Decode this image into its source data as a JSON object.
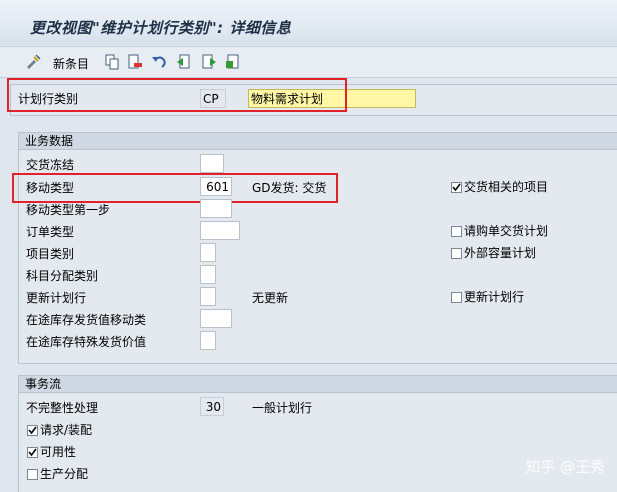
{
  "title": "更改视图\"维护计划行类别\": 详细信息",
  "toolbar": {
    "new_entries_label": "新条目",
    "icons": [
      "display-change-icon",
      "copy-icon",
      "delete-icon",
      "undo-icon",
      "previous-entry-icon",
      "next-entry-icon",
      "transport-icon"
    ]
  },
  "header": {
    "schedule_line_category_label": "计划行类别",
    "schedule_line_category_value": "CP",
    "description_value": "物料需求计划"
  },
  "business_data": {
    "title": "业务数据",
    "delivery_block_label": "交货冻结",
    "movement_type_label": "移动类型",
    "movement_type_value": "601",
    "movement_type_desc": "GD发货: 交货",
    "movement_type_1step_label": "移动类型第一步",
    "order_type_label": "订单类型",
    "item_category_label": "项目类别",
    "acct_assign_cat_label": "科目分配类别",
    "update_sched_line_label": "更新计划行",
    "update_sched_line_desc": "无更新",
    "stock_transfer_mvt_label": "在途库存发货值移动类",
    "stock_transfer_special_label": "在途库存特殊发货价值",
    "delivery_relevant_label": "交货相关的项目",
    "delivery_relevant_checked": true,
    "purch_req_delivery_label": "请购单交货计划",
    "purch_req_delivery_checked": false,
    "ext_capacity_label": "外部容量计划",
    "ext_capacity_checked": false,
    "update_sched_line_cb_label": "更新计划行",
    "update_sched_line_cb_checked": false
  },
  "transaction_flow": {
    "title": "事务流",
    "incompletion_label": "不完整性处理",
    "incompletion_value": "30",
    "incompletion_desc": "一般计划行",
    "requirements_label": "请求/装配",
    "requirements_checked": true,
    "availability_label": "可用性",
    "availability_checked": true,
    "production_alloc_label": "生产分配",
    "production_alloc_checked": false
  },
  "watermark": "知乎 @王秀",
  "colors": {
    "highlight_box": "#e0232b",
    "input_highlight": "#fff7a6",
    "background": "#dfe6ee"
  }
}
